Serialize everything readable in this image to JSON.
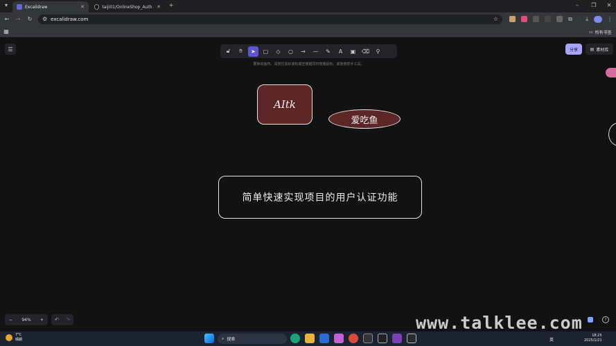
{
  "browser": {
    "tabs": [
      {
        "label": "Excalidraw"
      },
      {
        "label": "taiji01/OnlineShop_Auth at r"
      }
    ],
    "url": "excalidraw.com",
    "bookmarks_folder": "所有书签"
  },
  "app": {
    "hint_text": "要移动画布，请按住鼠标滚轮或空格键同时拖拽鼠标，或使用抓手工具。",
    "share_label": "分享",
    "library_label": "素材库",
    "zoom_level": "94%"
  },
  "canvas": {
    "shape1_text": "AItk",
    "shape2_text": "爱吃鱼",
    "shape3_text": "简单快速实现项目的用户认证功能"
  },
  "watermark": "www.talklee.com",
  "taskbar": {
    "weather_temp": "7°C",
    "weather_desc": "晴朗",
    "search_placeholder": "搜索",
    "lang": "英",
    "time": "18:25",
    "date": "2025/1/21"
  },
  "colors": {
    "accent": "#a8a5ff",
    "selected_tool": "#5b57d1",
    "shape_fill": "#5c2626"
  }
}
